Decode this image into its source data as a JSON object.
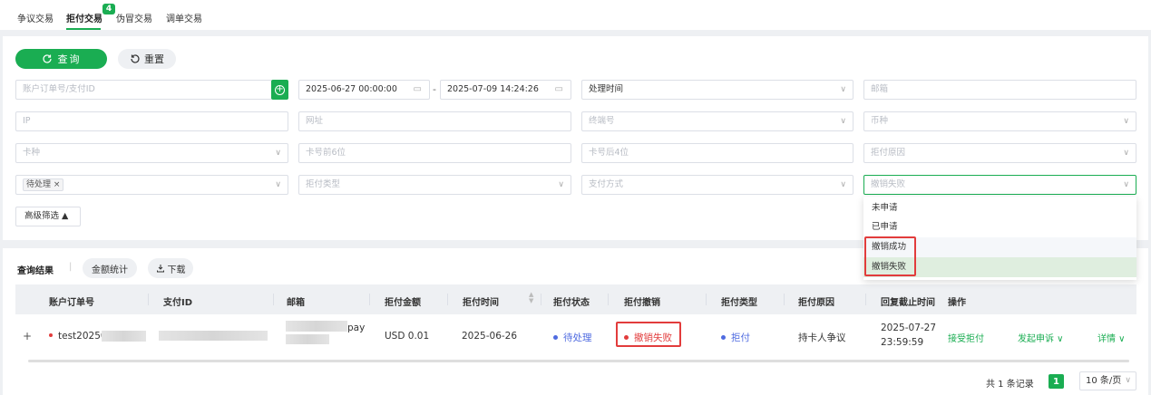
{
  "tabs": [
    {
      "label": "争议交易"
    },
    {
      "label": "拒付交易",
      "badge": "4"
    },
    {
      "label": "伪冒交易"
    },
    {
      "label": "调单交易"
    }
  ],
  "buttons": {
    "search": "查询",
    "reset": "重置",
    "advanced": "高级筛选 ▲"
  },
  "filters": {
    "order_id_placeholder": "账户订单号/支付ID",
    "date_start": "2025-06-27 00:00:00",
    "date_end": "2025-07-09 14:24:26",
    "date_sep": "-",
    "time_type": "处理时间",
    "email": "邮箱",
    "ip": "IP",
    "website": "网址",
    "terminal": "终端号",
    "currency": "币种",
    "card_type": "卡种",
    "card_first6": "卡号前6位",
    "card_last4": "卡号后4位",
    "chargeback_reason": "拒付原因",
    "status_tag": "待处理 ×",
    "chargeback_type": "拒付类型",
    "payment_method": "支付方式",
    "revoke_selected": "撤销失败"
  },
  "dropdown": {
    "options": [
      "未申请",
      "已申请",
      "撤销成功",
      "撤销失败"
    ]
  },
  "results": {
    "title": "查询结果",
    "sep": "|",
    "amount_stats": "金额统计",
    "download": "下载",
    "columns": [
      "账户订单号",
      "支付ID",
      "邮箱",
      "拒付金额",
      "拒付时间",
      "拒付状态",
      "拒付撤销",
      "拒付类型",
      "拒付原因",
      "回复截止时间",
      "操作"
    ],
    "row": {
      "expand": "+",
      "order_id": "test20250",
      "email_suffix": "pay",
      "amount": "USD 0.01",
      "time": "2025-06-26",
      "status": "待处理",
      "revoke": "撤销失败",
      "type": "拒付",
      "reason": "持卡人争议",
      "deadline_date": "2025-07-27",
      "deadline_time": "23:59:59",
      "accept": "接受拒付",
      "appeal": "发起申诉 ∨",
      "details": "详情 ∨"
    }
  },
  "pagination": {
    "total": "共 1 条记录",
    "page": "1",
    "size": "10 条/页"
  },
  "colors": {
    "primary": "#1aad52",
    "danger": "#e23c3c",
    "info": "#4f6be0"
  }
}
